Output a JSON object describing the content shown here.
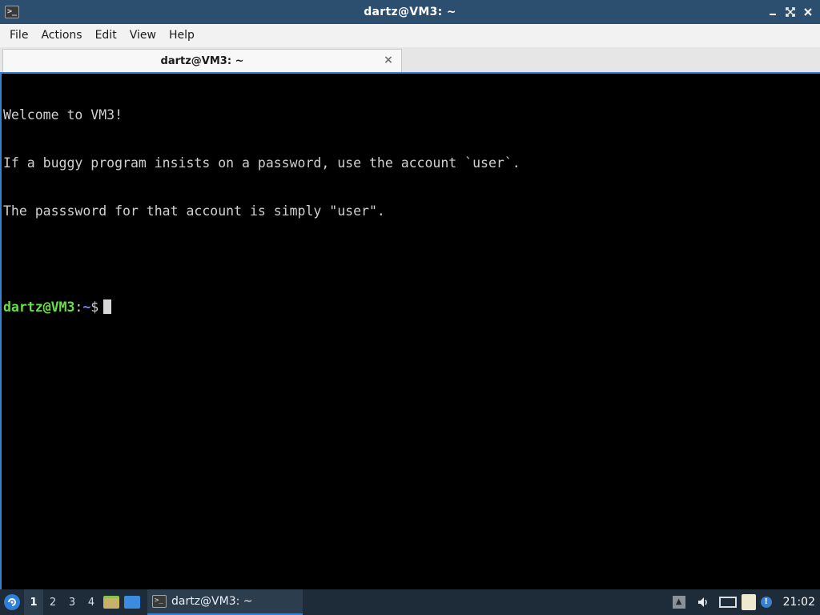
{
  "window": {
    "title": "dartz@VM3: ~",
    "app_icon": ">_",
    "controls": {
      "minimize_icon": "minimize-icon",
      "maximize_icon": "maximize-icon",
      "close_icon": "close-icon"
    }
  },
  "menubar": {
    "items": [
      "File",
      "Actions",
      "Edit",
      "View",
      "Help"
    ]
  },
  "tabs": [
    {
      "label": "dartz@VM3: ~",
      "close_glyph": "×"
    }
  ],
  "terminal": {
    "lines": [
      "Welcome to VM3!",
      "If a buggy program insists on a password, use the account `user`.",
      "The passsword for that account is simply \"user\".",
      ""
    ],
    "prompt": {
      "user_host": "dartz@VM3",
      "separator": ":",
      "path": "~",
      "symbol": "$"
    },
    "colors": {
      "background": "#000000",
      "text": "#d0d0d0",
      "prompt_user": "#67e041",
      "prompt_path": "#6b8cff"
    }
  },
  "taskbar": {
    "start_icon": "lxqt-menu-icon",
    "workspaces": [
      "1",
      "2",
      "3",
      "4"
    ],
    "active_workspace": "1",
    "quicklaunch": [
      {
        "icon": "file-manager-icon"
      },
      {
        "icon": "show-desktop-icon"
      }
    ],
    "task": {
      "label": "dartz@VM3: ~",
      "icon": "terminal-icon"
    },
    "tray": {
      "up_arrow": "▲",
      "volume_glyph": "🔊",
      "notify_glyph": "!",
      "clock": "21:02"
    }
  },
  "colors": {
    "titlebar": "#2d4f6f",
    "accent": "#3a7fd0",
    "taskbar": "#1e2b38"
  }
}
